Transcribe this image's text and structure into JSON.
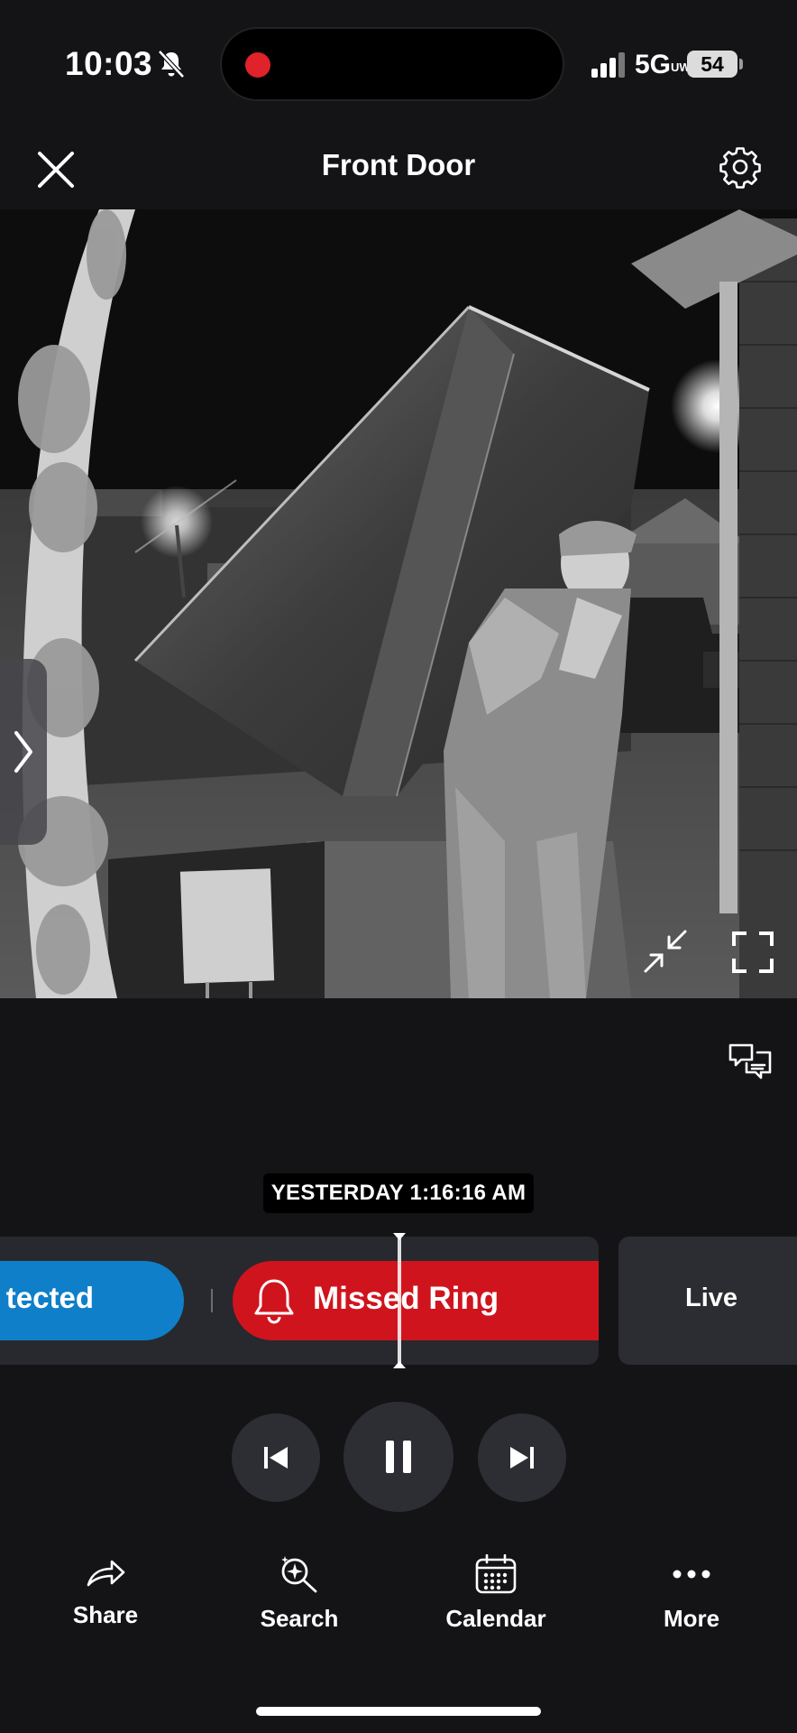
{
  "status_bar": {
    "time": "10:03",
    "network": "5G",
    "network_sup": "UW",
    "battery": "54",
    "icons": [
      "bell-slash-icon",
      "recording-dot-icon",
      "cellular-signal-icon",
      "battery-icon"
    ]
  },
  "header": {
    "title": "Front Door",
    "icons": [
      "close-icon",
      "gear-icon"
    ]
  },
  "video": {
    "icons": [
      "chevron-right-icon",
      "minimize-icon",
      "fullscreen-icon",
      "thumbs-down-feedback-icon"
    ]
  },
  "timeline": {
    "timestamp": "YESTERDAY 1:16:16 AM",
    "events": [
      {
        "label": "tected",
        "color": "#0f7fc9"
      },
      {
        "label": "Missed Ring",
        "color": "#d0141e",
        "icon": "bell-icon"
      }
    ],
    "live_label": "Live"
  },
  "player": {
    "icons": [
      "skip-previous-icon",
      "pause-icon",
      "skip-next-icon"
    ]
  },
  "bottom_nav": {
    "share": "Share",
    "search": "Search",
    "calendar": "Calendar",
    "more": "More",
    "icons": [
      "share-arrow-icon",
      "ai-search-icon",
      "calendar-icon",
      "ellipsis-icon"
    ]
  },
  "colors": {
    "background": "#141417",
    "motion_blue": "#0f7fc9",
    "ring_red": "#d0141e",
    "control_gray": "#2c2e33"
  }
}
